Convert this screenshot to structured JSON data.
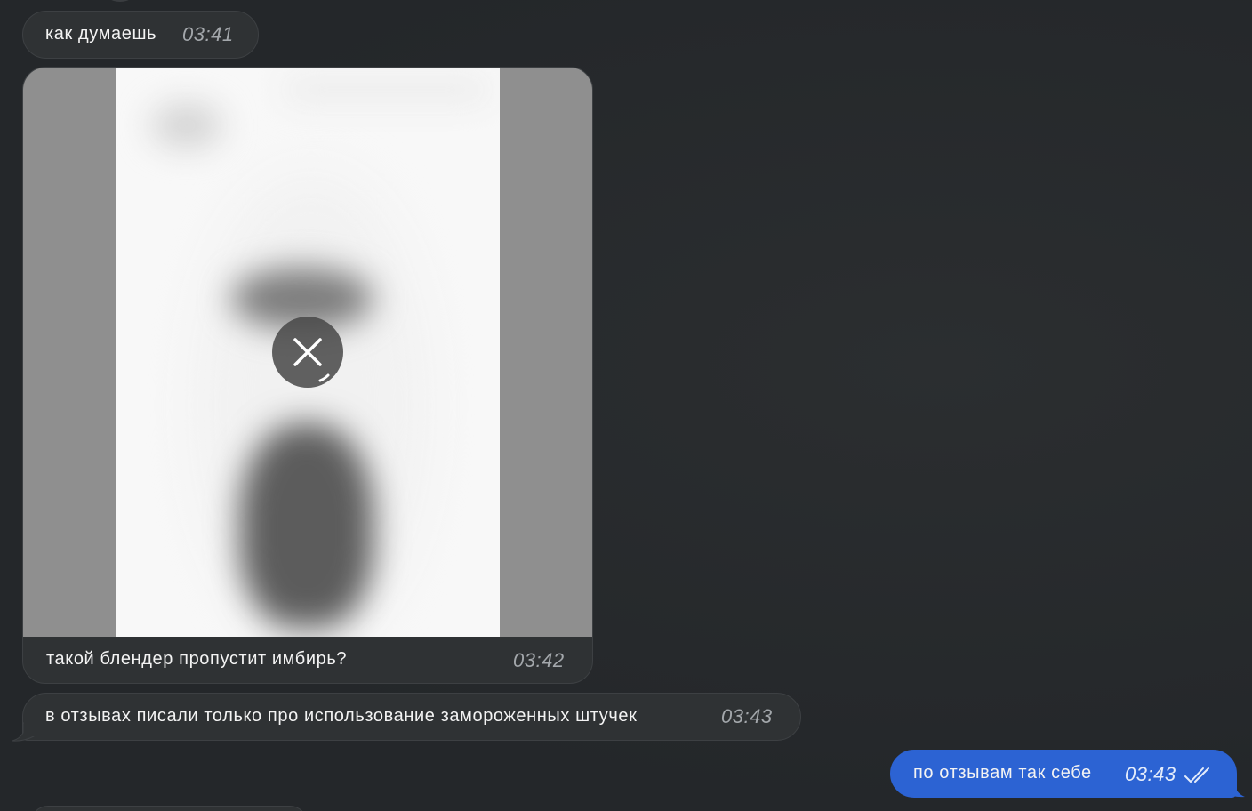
{
  "messages": [
    {
      "direction": "incoming",
      "text": "как думаешь",
      "time": "03:41"
    },
    {
      "direction": "incoming",
      "type": "image",
      "caption": "такой блендер пропустит имбирь?",
      "time": "03:42",
      "media_state": "download-cancel-icon"
    },
    {
      "direction": "incoming",
      "text": "в отзывах писали только про использование замороженных штучек",
      "time": "03:43"
    },
    {
      "direction": "outgoing",
      "text": "по отзывам так себе",
      "time": "03:43",
      "status_icon": "double-check-icon"
    }
  ],
  "colors": {
    "background": "#26292b",
    "incoming_bubble": "#2f3234",
    "outgoing_bubble": "#2c63d3",
    "time_text": "#a3a7ab"
  }
}
